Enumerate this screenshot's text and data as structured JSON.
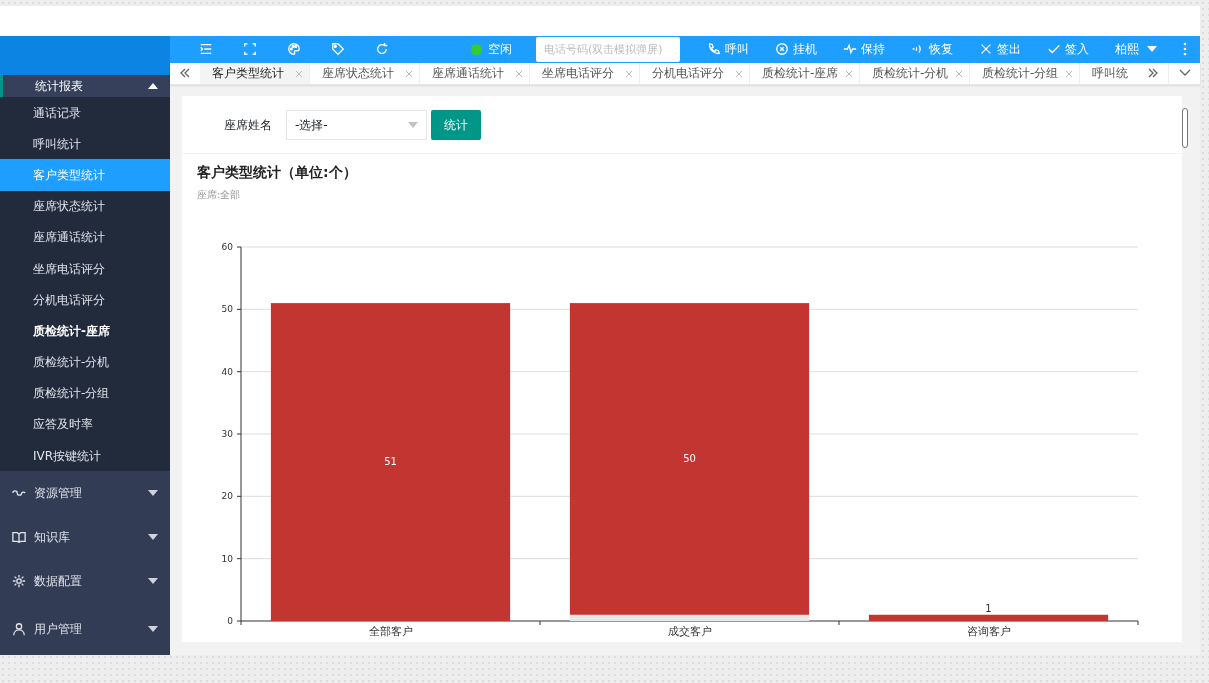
{
  "sidebar": {
    "group": {
      "label": "统计报表",
      "expanded": true
    },
    "items": [
      {
        "label": "通话记录",
        "selected": false,
        "bold": false
      },
      {
        "label": "呼叫统计",
        "selected": false,
        "bold": false
      },
      {
        "label": "客户类型统计",
        "selected": true,
        "bold": false
      },
      {
        "label": "座席状态统计",
        "selected": false,
        "bold": false
      },
      {
        "label": "座席通话统计",
        "selected": false,
        "bold": false
      },
      {
        "label": "坐席电话评分",
        "selected": false,
        "bold": false
      },
      {
        "label": "分机电话评分",
        "selected": false,
        "bold": false
      },
      {
        "label": "质检统计-座席",
        "selected": false,
        "bold": true
      },
      {
        "label": "质检统计-分机",
        "selected": false,
        "bold": false
      },
      {
        "label": "质检统计-分组",
        "selected": false,
        "bold": false
      },
      {
        "label": "应答及时率",
        "selected": false,
        "bold": false
      },
      {
        "label": "IVR按键统计",
        "selected": false,
        "bold": false
      }
    ],
    "groups": [
      {
        "label": "资源管理",
        "kind": "link"
      },
      {
        "label": "知识库",
        "kind": "book"
      },
      {
        "label": "数据配置",
        "kind": "gear"
      },
      {
        "label": "用户管理",
        "kind": "user"
      }
    ]
  },
  "header": {
    "status": {
      "label": "空闲",
      "color": "#33cc33"
    },
    "phone": {
      "placeholder": "电话号码(双击模拟弹屏)"
    },
    "actions": [
      {
        "label": "呼叫",
        "kind": "phone"
      },
      {
        "label": "挂机",
        "kind": "hangup"
      },
      {
        "label": "保持",
        "kind": "pulse"
      },
      {
        "label": "恢复",
        "kind": "wave"
      },
      {
        "label": "签出",
        "kind": "x"
      },
      {
        "label": "签入",
        "kind": "check"
      }
    ],
    "user": "柏熙"
  },
  "tabs": [
    {
      "label": "客户类型统计",
      "selected": true,
      "closable": true
    },
    {
      "label": "座席状态统计",
      "selected": false,
      "closable": true
    },
    {
      "label": "座席通话统计",
      "selected": false,
      "closable": true
    },
    {
      "label": "坐席电话评分",
      "selected": false,
      "closable": true
    },
    {
      "label": "分机电话评分",
      "selected": false,
      "closable": true
    },
    {
      "label": "质检统计-座席",
      "selected": false,
      "closable": true
    },
    {
      "label": "质检统计-分机",
      "selected": false,
      "closable": true
    },
    {
      "label": "质检统计-分组",
      "selected": false,
      "closable": true
    },
    {
      "label": "呼叫统",
      "selected": false,
      "closable": false
    }
  ],
  "filter": {
    "label": "座席姓名",
    "select": "-选择-",
    "button": "统计"
  },
  "report": {
    "title": "客户类型统计（单位:个）",
    "subtitle": "座席:全部",
    "chart_data": {
      "type": "bar",
      "stacked": true,
      "grid": true,
      "categories": [
        "全部客户",
        "成交客户",
        "咨询客户"
      ],
      "ylim": [
        0,
        60
      ],
      "yticks": [
        0,
        10,
        20,
        30,
        40,
        50,
        60
      ],
      "value_labels": [
        [
          null,
          null,
          null
        ],
        [
          "51",
          "50",
          "1"
        ]
      ],
      "series": [
        {
          "color": "#e8e8e8",
          "values": [
            0,
            1,
            0
          ]
        },
        {
          "color": "#c23531",
          "values": [
            51,
            50,
            1
          ]
        }
      ]
    }
  }
}
